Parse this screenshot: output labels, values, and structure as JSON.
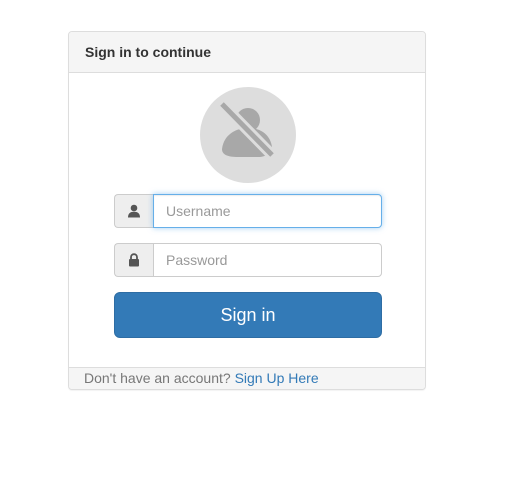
{
  "panel": {
    "title": "Sign in to continue"
  },
  "avatar": {
    "icon": "user-slash-icon"
  },
  "username": {
    "icon": "user-icon",
    "placeholder": "Username",
    "value": ""
  },
  "password": {
    "icon": "lock-icon",
    "placeholder": "Password",
    "value": ""
  },
  "signin": {
    "label": "Sign in"
  },
  "footer": {
    "text": "Don't have an account? ",
    "link": "Sign Up Here"
  },
  "colors": {
    "primary": "#337ab7",
    "focus_border": "#66afe9",
    "panel_heading_bg": "#f5f5f5",
    "avatar_bg": "#dddddd"
  }
}
